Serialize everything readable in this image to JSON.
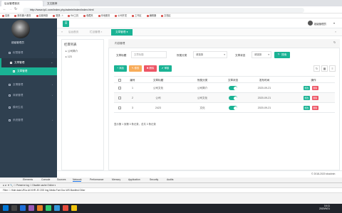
{
  "browser": {
    "tabs": [
      {
        "label": "后台管理首页"
      },
      {
        "label": "文文推荐"
      }
    ],
    "url": "http://www.tp1.com/index.php/admin/index/index.html",
    "bookmarks": [
      "应用",
      "新机器人服务",
      "百度网盘",
      "登录 - t",
      "BA工具",
      "收藏夹",
      "本地服务",
      "公司开发",
      "工作区",
      "编辑器",
      "文档区"
    ]
  },
  "sidebar": {
    "username": "超级管理员",
    "items": [
      {
        "label": "权限管理"
      },
      {
        "label": "文章管理"
      },
      {
        "label": "文章管理"
      },
      {
        "label": "友情管理"
      },
      {
        "label": "商家管理"
      },
      {
        "label": "模块生成"
      },
      {
        "label": "系统管理"
      }
    ]
  },
  "header": {
    "menu_icon": "≡",
    "user": "超级管理员"
  },
  "page_tabs": [
    {
      "label": "后台首页"
    },
    {
      "label": "栏目管理"
    },
    {
      "label": "文章管理"
    }
  ],
  "tree": {
    "title": "栏目列表",
    "nodes": [
      "公司简介",
      "123"
    ]
  },
  "panel": {
    "title": "内容管理",
    "filters": {
      "title_label": "文章标题",
      "title_placeholder": "文章标题",
      "category_label": "所属分类",
      "category_value": "请选择",
      "status_label": "文章状态",
      "status_value": "请选择",
      "search_label": "搜索"
    },
    "actions": {
      "add": "添加",
      "edit": "修改",
      "delete": "删除",
      "review": "审核"
    },
    "table": {
      "columns": [
        "编号",
        "文章标题",
        "所属分类",
        "文章状态",
        "发布时间",
        "操作"
      ],
      "rows": [
        {
          "id": "1",
          "title": "公司文化",
          "category": "公司简介",
          "date": "2020-09-21"
        },
        {
          "id": "2",
          "title": "公司",
          "category": "公司文化",
          "date": "2020-09-21"
        },
        {
          "id": "3",
          "title": "2423",
          "category": "文化",
          "date": "2020-09-21"
        }
      ],
      "row_edit": "修改",
      "row_delete": "删除"
    },
    "pagination": "显示第 1 到第 3 条记录，总共 3 条记录"
  },
  "footer": {
    "copyright": "© 2018-2020 shadmin"
  },
  "devtools": {
    "tabs": [
      "Elements",
      "Console",
      "Sources",
      "Network",
      "Performance",
      "Memory",
      "Application",
      "Security",
      "Audits"
    ],
    "toolbar": "●  ⊘  ▼  🔍  ☐ Preserve log  ☐ Disable cache  Online ▾",
    "filter": "Filter  ☐ Hide data URLs  All  XHR  JS  CSS  Img  Media  Font  Doc  WS  Manifest  Other"
  },
  "taskbar": {
    "time": "16:11",
    "date": "2020/9/21"
  },
  "colors": {
    "sidebar_bg": "#2f4050",
    "primary": "#1ab394",
    "danger": "#ed5565",
    "warning": "#f8ac59"
  }
}
